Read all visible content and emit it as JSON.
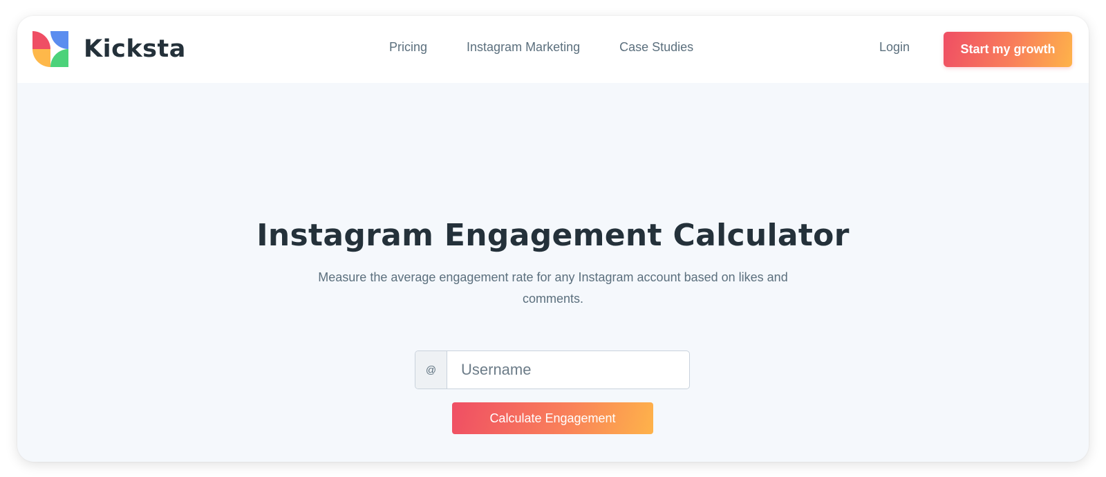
{
  "brand": {
    "name": "Kicksta",
    "logo_colors": [
      "#5b8def",
      "#ef4e64",
      "#feb84a",
      "#4cd27a"
    ]
  },
  "nav": {
    "items": [
      {
        "label": "Pricing"
      },
      {
        "label": "Instagram Marketing"
      },
      {
        "label": "Case Studies"
      }
    ],
    "login_label": "Login",
    "cta_label": "Start my growth"
  },
  "hero": {
    "title": "Instagram Engagement Calculator",
    "subtitle": "Measure the average engagement rate for any Instagram account based on likes and comments.",
    "input_prefix": "@",
    "input_placeholder": "Username",
    "input_value": "",
    "button_label": "Calculate Engagement"
  },
  "colors": {
    "accent_start": "#ef4e64",
    "accent_end": "#feb34a",
    "text_dark": "#24313a",
    "text_muted": "#5b6f7d",
    "background": "#f5f8fc"
  }
}
